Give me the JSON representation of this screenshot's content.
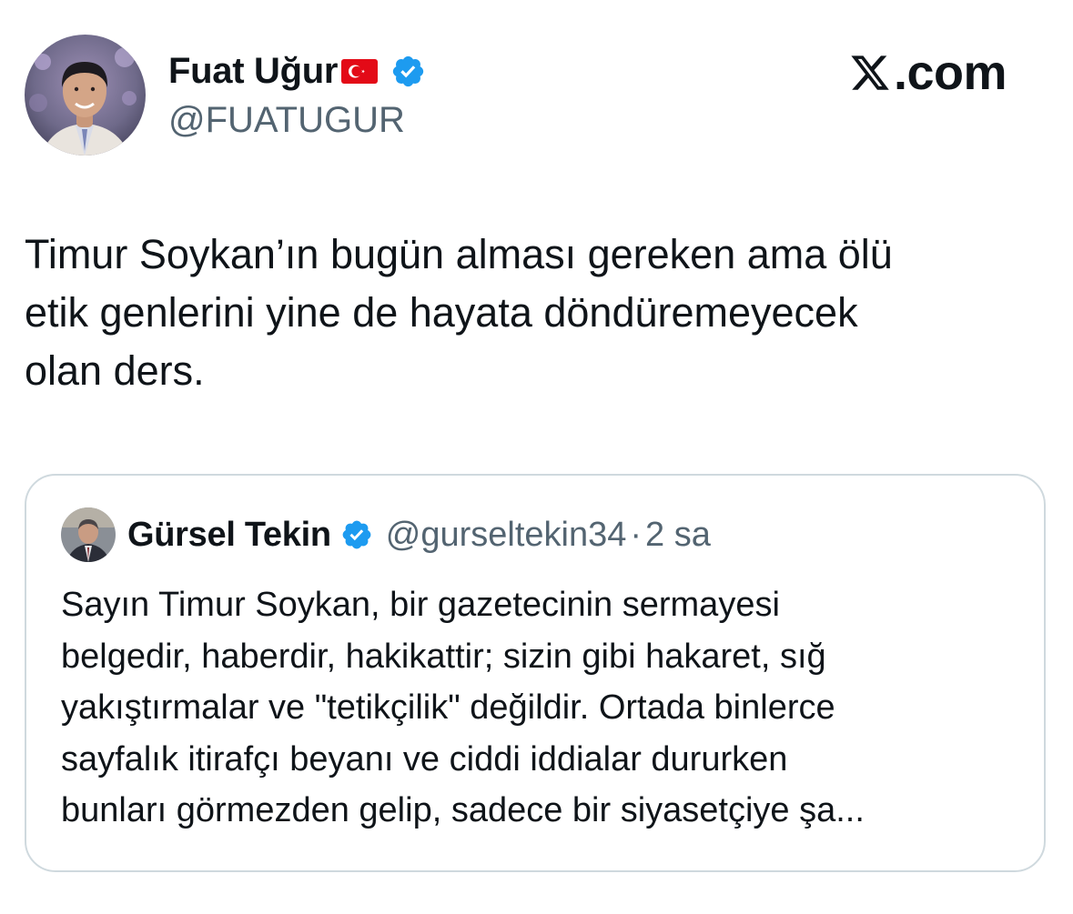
{
  "author": {
    "display_name": "Fuat Uğur",
    "handle": "@FUATUGUR",
    "flag_icon": "turkey-flag-icon",
    "verified_icon": "verified-badge-icon"
  },
  "brand": {
    "text": ".com",
    "icon": "x-logo-icon"
  },
  "tweet": {
    "text": "Timur Soykan’ın bugün alması gereken ama ölü\netik genlerini yine de hayata döndüremeyecek\nolan ders."
  },
  "quoted_tweet": {
    "display_name": "Gürsel Tekin",
    "handle": "@gurseltekin34",
    "separator": "·",
    "time": "2 sa",
    "verified_icon": "verified-badge-icon",
    "text": "Sayın Timur Soykan, bir gazetecinin sermayesi\nbelgedir, haberdir, hakikattir; sizin gibi hakaret, sığ\nyakıştırmalar ve \"tetikçilik\" değildir. Ortada binlerce\nsayfalık itirafçı beyanı ve ciddi iddialar dururken\nbunları görmezden gelip, sadece bir siyasetçiye şa..."
  },
  "colors": {
    "text_primary": "#0f1419",
    "text_secondary": "#536471",
    "verified_blue": "#1d9bf0",
    "card_border": "#cfd9de",
    "flag_red": "#e30a17"
  }
}
